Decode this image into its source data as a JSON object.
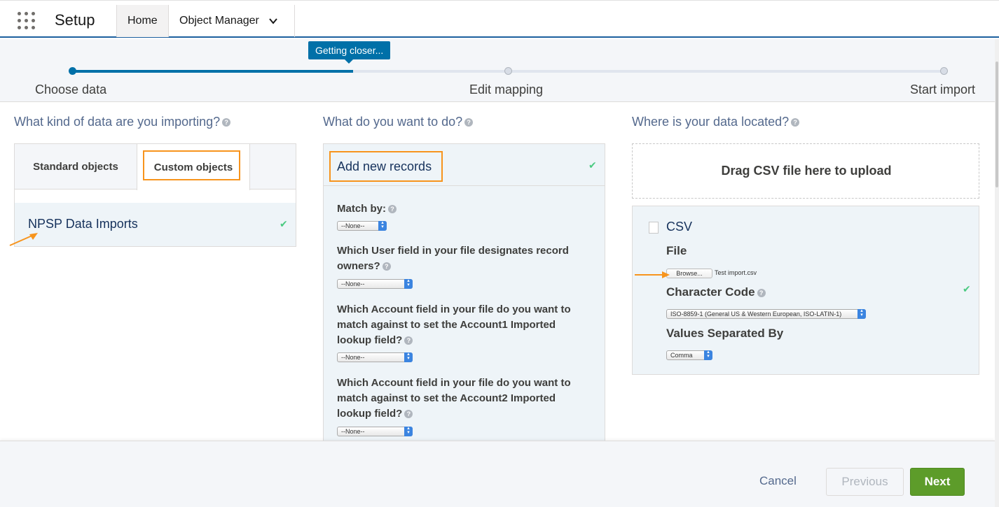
{
  "app": {
    "title": "Setup"
  },
  "nav": {
    "tabs": [
      {
        "label": "Home"
      },
      {
        "label": "Object Manager"
      }
    ]
  },
  "progress": {
    "tooltip": "Getting closer...",
    "steps": [
      {
        "label": "Choose data"
      },
      {
        "label": "Edit mapping"
      },
      {
        "label": "Start import"
      }
    ],
    "accent": "#0070a8"
  },
  "column1": {
    "title": "What kind of data are you importing?",
    "tabs": [
      {
        "label": "Standard objects"
      },
      {
        "label": "Custom objects"
      }
    ],
    "selected_item": "NPSP Data Imports"
  },
  "column2": {
    "title": "What do you want to do?",
    "action": "Add new records",
    "match_by_label": "Match by:",
    "match_by_value": "--None--",
    "questions": [
      {
        "label": "Which User field in your file designates record owners?",
        "value": "--None--"
      },
      {
        "label": "Which Account field in your file do you want to match against to set the Account1 Imported lookup field?",
        "value": "--None--"
      },
      {
        "label": "Which Account field in your file do you want to match against to set the Account2 Imported lookup field?",
        "value": "--None--"
      }
    ]
  },
  "column3": {
    "title": "Where is your data located?",
    "dropzone": "Drag CSV file here to upload",
    "source": "CSV",
    "file_label": "File",
    "browse_label": "Browse...",
    "file_name": "Test import.csv",
    "charcode_label": "Character Code",
    "charcode_value": "ISO-8859-1 (General US & Western European, ISO-LATIN-1)",
    "separator_label": "Values Separated By",
    "separator_value": "Comma"
  },
  "footer": {
    "cancel": "Cancel",
    "previous": "Previous",
    "next": "Next",
    "next_color": "#5d9c2a"
  },
  "annotation_color": "#f7941d",
  "check_icon": "✔"
}
